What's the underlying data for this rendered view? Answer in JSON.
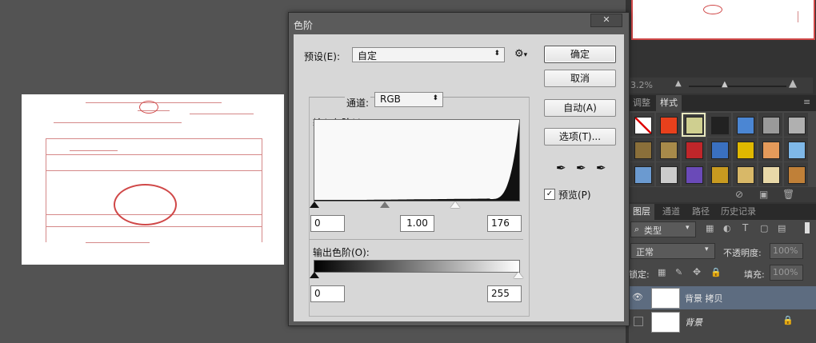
{
  "dialog": {
    "title": "色阶",
    "close_symbol": "✕",
    "preset_label": "预设(E):",
    "preset_value": "自定",
    "channel_label": "通道:",
    "channel_value": "RGB",
    "input_levels_label": "输入色阶(I):",
    "input_black": "0",
    "input_gamma": "1.00",
    "input_white": "176",
    "output_levels_label": "输出色阶(O):",
    "output_black": "0",
    "output_white": "255",
    "buttons": {
      "ok": "确定",
      "cancel": "取消",
      "auto": "自动(A)",
      "options": "选项(T)..."
    },
    "preview_label": "预览(P)",
    "preview_checked": true,
    "gear_symbol": "⚙",
    "histogram": {
      "input_white_point": 176,
      "input_black_point": 0,
      "gamma": 1.0
    }
  },
  "navigator": {
    "zoom": "3.2%"
  },
  "styles_panel": {
    "tabs": [
      "调整",
      "样式"
    ],
    "active_tab": "样式",
    "swatch_colors": [
      [
        "#ffffff",
        "#e8401c",
        "#cfcf90",
        "#222222",
        "#4b86d3",
        "#9a9a9a",
        "#b0b0b0"
      ],
      [
        "#8a6f3a",
        "#a78a4a",
        "#c0262a",
        "#3a70c0",
        "#e0b800",
        "#e49a5a",
        "#7fb8e8"
      ],
      [
        "#6b9ad0",
        "#cccccc",
        "#6a4ab8",
        "#c89a20",
        "#d8b868",
        "#e8d8a8",
        "#c08038"
      ]
    ]
  },
  "layers_panel": {
    "tabs": [
      "图层",
      "通道",
      "路径",
      "历史记录"
    ],
    "active_tab": "图层",
    "filter_kind": "类型",
    "blend_mode": "正常",
    "opacity_label": "不透明度:",
    "opacity_value": "100%",
    "lock_label": "锁定:",
    "fill_label": "填充:",
    "fill_value": "100%",
    "layers": [
      {
        "name": "背景 拷贝",
        "visible": true,
        "selected": true,
        "locked": false
      },
      {
        "name": "背景",
        "visible": false,
        "selected": false,
        "locked": true
      }
    ]
  },
  "icons": {
    "eye": "eye-icon",
    "lock": "lock-icon",
    "gear": "gear-icon",
    "eyedropper": "eyedropper-icon"
  }
}
